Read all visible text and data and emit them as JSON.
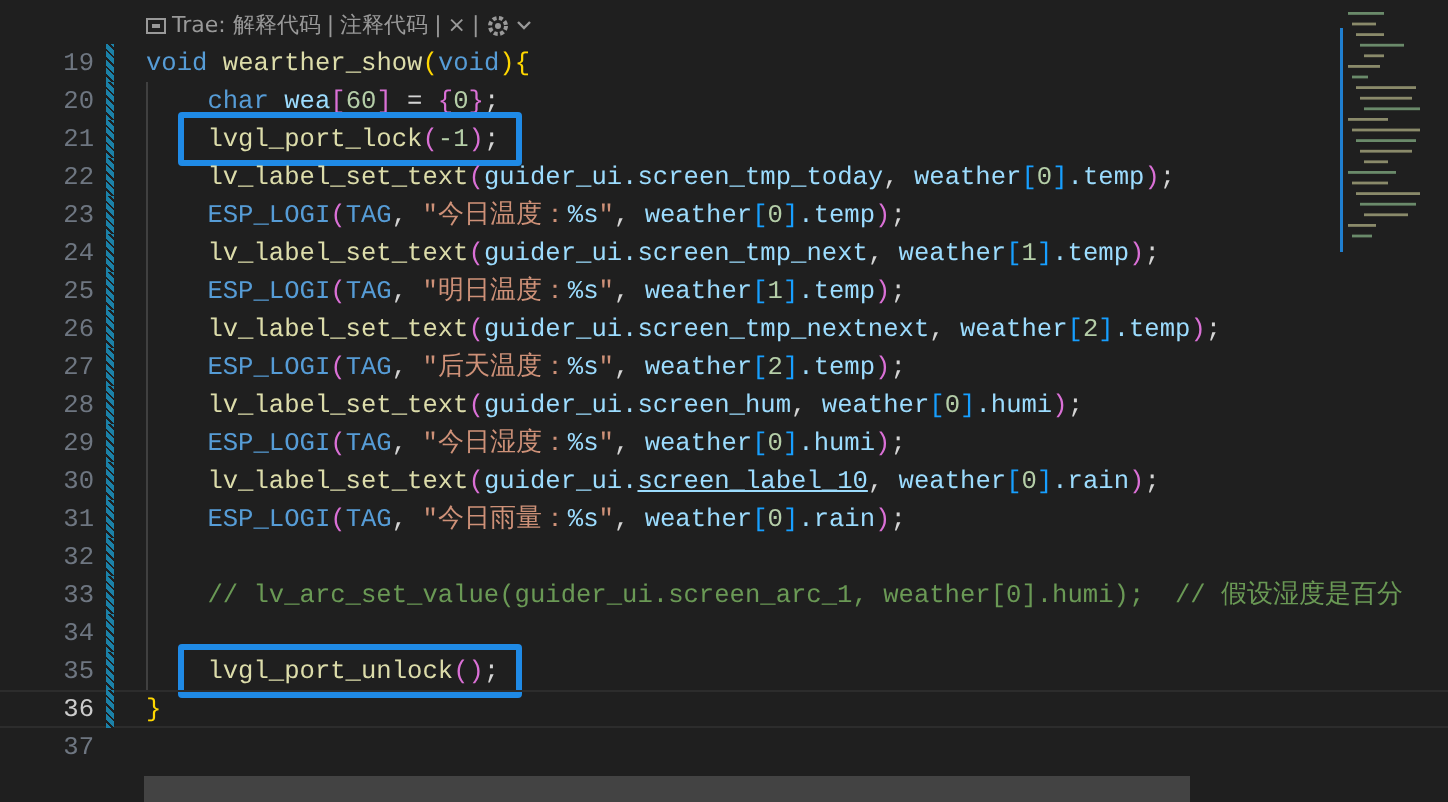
{
  "codelens": {
    "actions": [
      {
        "label": "Trae: 解释代码",
        "kind": "brand"
      },
      {
        "label": "注释代码",
        "kind": "text"
      },
      {
        "label": "×",
        "kind": "text"
      }
    ],
    "separator": "|"
  },
  "lines": [
    {
      "number": "19",
      "current": false,
      "boxed": false,
      "tokens": [
        {
          "kind": "kw",
          "text": "void "
        },
        {
          "kind": "fn",
          "text": "wearther_show"
        },
        {
          "kind": "b1",
          "text": "("
        },
        {
          "kind": "kw",
          "text": "void"
        },
        {
          "kind": "b1",
          "text": "){"
        }
      ],
      "children": [
        {
          "number": "20",
          "current": false,
          "boxed": false,
          "tokens": [
            {
              "kind": "kw",
              "text": "char "
            },
            {
              "kind": "var",
              "text": "wea"
            },
            {
              "kind": "b2",
              "text": "["
            },
            {
              "kind": "num",
              "text": "60"
            },
            {
              "kind": "b2",
              "text": "]"
            },
            {
              "kind": "p",
              "text": " = "
            },
            {
              "kind": "b2",
              "text": "{"
            },
            {
              "kind": "num",
              "text": "0"
            },
            {
              "kind": "b2",
              "text": "}"
            },
            {
              "kind": "p",
              "text": ";"
            }
          ]
        },
        {
          "number": "21",
          "current": false,
          "boxed": true,
          "tokens": [
            {
              "kind": "fn",
              "text": "lvgl_port_lock"
            },
            {
              "kind": "b2",
              "text": "("
            },
            {
              "kind": "num",
              "text": "-1"
            },
            {
              "kind": "b2",
              "text": ")"
            },
            {
              "kind": "p",
              "text": ";"
            }
          ]
        },
        {
          "number": "22",
          "current": false,
          "boxed": false,
          "tokens": [
            {
              "kind": "fn",
              "text": "lv_label_set_text"
            },
            {
              "kind": "b2",
              "text": "("
            },
            {
              "kind": "var",
              "text": "guider_ui.screen_tmp_today"
            },
            {
              "kind": "p",
              "text": ", "
            },
            {
              "kind": "var",
              "text": "weather"
            },
            {
              "kind": "b3",
              "text": "["
            },
            {
              "kind": "num",
              "text": "0"
            },
            {
              "kind": "b3",
              "text": "]"
            },
            {
              "kind": "var",
              "text": ".temp"
            },
            {
              "kind": "b2",
              "text": ")"
            },
            {
              "kind": "p",
              "text": ";"
            }
          ]
        },
        {
          "number": "23",
          "current": false,
          "boxed": false,
          "tokens": [
            {
              "kind": "macro",
              "text": "ESP_LOGI"
            },
            {
              "kind": "b2",
              "text": "("
            },
            {
              "kind": "macro",
              "text": "TAG"
            },
            {
              "kind": "p",
              "text": ", "
            },
            {
              "kind": "str",
              "text": "\"今日温度："
            },
            {
              "kind": "fmt",
              "text": "%s"
            },
            {
              "kind": "str",
              "text": "\""
            },
            {
              "kind": "p",
              "text": ", "
            },
            {
              "kind": "var",
              "text": "weather"
            },
            {
              "kind": "b3",
              "text": "["
            },
            {
              "kind": "num",
              "text": "0"
            },
            {
              "kind": "b3",
              "text": "]"
            },
            {
              "kind": "var",
              "text": ".temp"
            },
            {
              "kind": "b2",
              "text": ")"
            },
            {
              "kind": "p",
              "text": ";"
            }
          ]
        },
        {
          "number": "24",
          "current": false,
          "boxed": false,
          "tokens": [
            {
              "kind": "fn",
              "text": "lv_label_set_text"
            },
            {
              "kind": "b2",
              "text": "("
            },
            {
              "kind": "var",
              "text": "guider_ui.screen_tmp_next"
            },
            {
              "kind": "p",
              "text": ", "
            },
            {
              "kind": "var",
              "text": "weather"
            },
            {
              "kind": "b3",
              "text": "["
            },
            {
              "kind": "num",
              "text": "1"
            },
            {
              "kind": "b3",
              "text": "]"
            },
            {
              "kind": "var",
              "text": ".temp"
            },
            {
              "kind": "b2",
              "text": ")"
            },
            {
              "kind": "p",
              "text": ";"
            }
          ]
        },
        {
          "number": "25",
          "current": false,
          "boxed": false,
          "tokens": [
            {
              "kind": "macro",
              "text": "ESP_LOGI"
            },
            {
              "kind": "b2",
              "text": "("
            },
            {
              "kind": "macro",
              "text": "TAG"
            },
            {
              "kind": "p",
              "text": ", "
            },
            {
              "kind": "str",
              "text": "\"明日温度："
            },
            {
              "kind": "fmt",
              "text": "%s"
            },
            {
              "kind": "str",
              "text": "\""
            },
            {
              "kind": "p",
              "text": ", "
            },
            {
              "kind": "var",
              "text": "weather"
            },
            {
              "kind": "b3",
              "text": "["
            },
            {
              "kind": "num",
              "text": "1"
            },
            {
              "kind": "b3",
              "text": "]"
            },
            {
              "kind": "var",
              "text": ".temp"
            },
            {
              "kind": "b2",
              "text": ")"
            },
            {
              "kind": "p",
              "text": ";"
            }
          ]
        },
        {
          "number": "26",
          "current": false,
          "boxed": false,
          "tokens": [
            {
              "kind": "fn",
              "text": "lv_label_set_text"
            },
            {
              "kind": "b2",
              "text": "("
            },
            {
              "kind": "var",
              "text": "guider_ui.screen_tmp_nextnext"
            },
            {
              "kind": "p",
              "text": ", "
            },
            {
              "kind": "var",
              "text": "weather"
            },
            {
              "kind": "b3",
              "text": "["
            },
            {
              "kind": "num",
              "text": "2"
            },
            {
              "kind": "b3",
              "text": "]"
            },
            {
              "kind": "var",
              "text": ".temp"
            },
            {
              "kind": "b2",
              "text": ")"
            },
            {
              "kind": "p",
              "text": ";"
            }
          ]
        },
        {
          "number": "27",
          "current": false,
          "boxed": false,
          "tokens": [
            {
              "kind": "macro",
              "text": "ESP_LOGI"
            },
            {
              "kind": "b2",
              "text": "("
            },
            {
              "kind": "macro",
              "text": "TAG"
            },
            {
              "kind": "p",
              "text": ", "
            },
            {
              "kind": "str",
              "text": "\"后天温度："
            },
            {
              "kind": "fmt",
              "text": "%s"
            },
            {
              "kind": "str",
              "text": "\""
            },
            {
              "kind": "p",
              "text": ", "
            },
            {
              "kind": "var",
              "text": "weather"
            },
            {
              "kind": "b3",
              "text": "["
            },
            {
              "kind": "num",
              "text": "2"
            },
            {
              "kind": "b3",
              "text": "]"
            },
            {
              "kind": "var",
              "text": ".temp"
            },
            {
              "kind": "b2",
              "text": ")"
            },
            {
              "kind": "p",
              "text": ";"
            }
          ]
        },
        {
          "number": "28",
          "current": false,
          "boxed": false,
          "tokens": [
            {
              "kind": "fn",
              "text": "lv_label_set_text"
            },
            {
              "kind": "b2",
              "text": "("
            },
            {
              "kind": "var",
              "text": "guider_ui.screen_hum"
            },
            {
              "kind": "p",
              "text": ", "
            },
            {
              "kind": "var",
              "text": "weather"
            },
            {
              "kind": "b3",
              "text": "["
            },
            {
              "kind": "num",
              "text": "0"
            },
            {
              "kind": "b3",
              "text": "]"
            },
            {
              "kind": "var",
              "text": ".humi"
            },
            {
              "kind": "b2",
              "text": ")"
            },
            {
              "kind": "p",
              "text": ";"
            }
          ]
        },
        {
          "number": "29",
          "current": false,
          "boxed": false,
          "tokens": [
            {
              "kind": "macro",
              "text": "ESP_LOGI"
            },
            {
              "kind": "b2",
              "text": "("
            },
            {
              "kind": "macro",
              "text": "TAG"
            },
            {
              "kind": "p",
              "text": ", "
            },
            {
              "kind": "str",
              "text": "\"今日湿度："
            },
            {
              "kind": "fmt",
              "text": "%s"
            },
            {
              "kind": "str",
              "text": "\""
            },
            {
              "kind": "p",
              "text": ", "
            },
            {
              "kind": "var",
              "text": "weather"
            },
            {
              "kind": "b3",
              "text": "["
            },
            {
              "kind": "num",
              "text": "0"
            },
            {
              "kind": "b3",
              "text": "]"
            },
            {
              "kind": "var",
              "text": ".humi"
            },
            {
              "kind": "b2",
              "text": ")"
            },
            {
              "kind": "p",
              "text": ";"
            }
          ]
        },
        {
          "number": "30",
          "current": false,
          "boxed": false,
          "tokens": [
            {
              "kind": "fn",
              "text": "lv_label_set_text"
            },
            {
              "kind": "b2",
              "text": "("
            },
            {
              "kind": "var",
              "text": "guider_ui."
            },
            {
              "kind": "link",
              "text": "screen_label_10"
            },
            {
              "kind": "p",
              "text": ", "
            },
            {
              "kind": "var",
              "text": "weather"
            },
            {
              "kind": "b3",
              "text": "["
            },
            {
              "kind": "num",
              "text": "0"
            },
            {
              "kind": "b3",
              "text": "]"
            },
            {
              "kind": "var",
              "text": ".rain"
            },
            {
              "kind": "b2",
              "text": ")"
            },
            {
              "kind": "p",
              "text": ";"
            }
          ]
        },
        {
          "number": "31",
          "current": false,
          "boxed": false,
          "tokens": [
            {
              "kind": "macro",
              "text": "ESP_LOGI"
            },
            {
              "kind": "b2",
              "text": "("
            },
            {
              "kind": "macro",
              "text": "TAG"
            },
            {
              "kind": "p",
              "text": ", "
            },
            {
              "kind": "str",
              "text": "\"今日雨量："
            },
            {
              "kind": "fmt",
              "text": "%s"
            },
            {
              "kind": "str",
              "text": "\""
            },
            {
              "kind": "p",
              "text": ", "
            },
            {
              "kind": "var",
              "text": "weather"
            },
            {
              "kind": "b3",
              "text": "["
            },
            {
              "kind": "num",
              "text": "0"
            },
            {
              "kind": "b3",
              "text": "]"
            },
            {
              "kind": "var",
              "text": ".rain"
            },
            {
              "kind": "b2",
              "text": ")"
            },
            {
              "kind": "p",
              "text": ";"
            }
          ]
        },
        {
          "number": "32",
          "current": false,
          "boxed": false
        },
        {
          "number": "33",
          "current": false,
          "boxed": false,
          "tokens": [
            {
              "kind": "cm",
              "text": "// lv_arc_set_value(guider_ui.screen_arc_1, weather[0].humi);  // 假设湿度是百分"
            }
          ]
        },
        {
          "number": "34",
          "current": false,
          "boxed": false
        },
        {
          "number": "35",
          "current": false,
          "boxed": true,
          "tokens": [
            {
              "kind": "fn",
              "text": "lvgl_port_unlock"
            },
            {
              "kind": "b2",
              "text": "()"
            },
            {
              "kind": "p",
              "text": ";"
            }
          ]
        }
      ]
    },
    {
      "number": "36",
      "current": true,
      "boxed": false,
      "tokens": [
        {
          "kind": "b1",
          "text": "}"
        }
      ]
    },
    {
      "number": "37",
      "current": false,
      "boxed": false
    }
  ]
}
